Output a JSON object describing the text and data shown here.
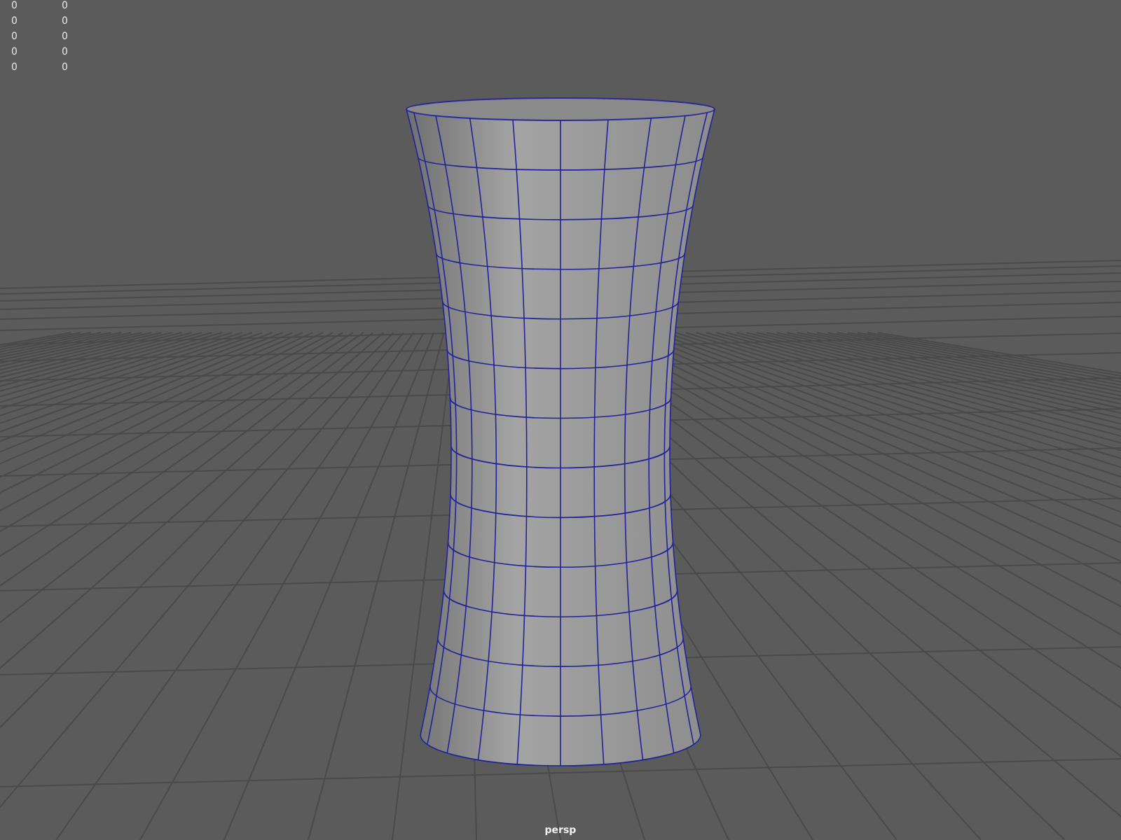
{
  "hud_rows": [
    {
      "value_1": "0",
      "value_2": "0"
    },
    {
      "value_1": "0",
      "value_2": "0"
    },
    {
      "value_1": "0",
      "value_2": "0"
    },
    {
      "value_1": "0",
      "value_2": "0"
    },
    {
      "value_1": "0",
      "value_2": "0"
    }
  ],
  "camera_label": "persp"
}
